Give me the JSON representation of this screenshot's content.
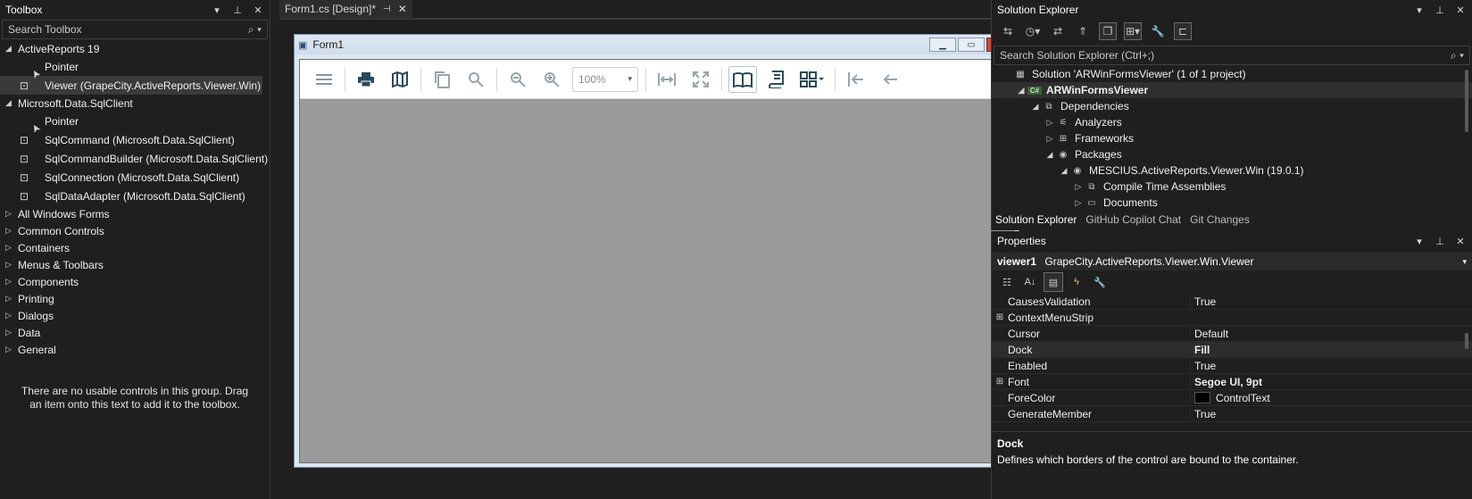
{
  "toolbox": {
    "title": "Toolbox",
    "search_placeholder": "Search Toolbox",
    "groups": [
      {
        "label": "ActiveReports 19",
        "expanded": true,
        "items": [
          "Pointer",
          "Viewer (GrapeCity.ActiveReports.Viewer.Win)"
        ]
      },
      {
        "label": "Microsoft.Data.SqlClient",
        "expanded": true,
        "items": [
          "Pointer",
          "SqlCommand (Microsoft.Data.SqlClient)",
          "SqlCommandBuilder (Microsoft.Data.SqlClient)",
          "SqlConnection (Microsoft.Data.SqlClient)",
          "SqlDataAdapter (Microsoft.Data.SqlClient)"
        ]
      },
      {
        "label": "All Windows Forms"
      },
      {
        "label": "Common Controls"
      },
      {
        "label": "Containers"
      },
      {
        "label": "Menus & Toolbars"
      },
      {
        "label": "Components"
      },
      {
        "label": "Printing"
      },
      {
        "label": "Dialogs"
      },
      {
        "label": "Data"
      },
      {
        "label": "General"
      }
    ],
    "empty_message": "There are no usable controls in this group. Drag an item onto this text to add it to the toolbox."
  },
  "document": {
    "tab_label": "Form1.cs [Design]*",
    "form_title": "Form1",
    "zoom": "100%"
  },
  "solution_explorer": {
    "title": "Solution Explorer",
    "search_placeholder": "Search Solution Explorer (Ctrl+;)",
    "tree": [
      {
        "label": "Solution 'ARWinFormsViewer' (1 of 1 project)",
        "level": 0,
        "tri": ""
      },
      {
        "label": "ARWinFormsViewer",
        "level": 1,
        "tri": "◢"
      },
      {
        "label": "Dependencies",
        "level": 2,
        "tri": "◢"
      },
      {
        "label": "Analyzers",
        "level": 3,
        "tri": "▷"
      },
      {
        "label": "Frameworks",
        "level": 3,
        "tri": "▷"
      },
      {
        "label": "Packages",
        "level": 3,
        "tri": "◢"
      },
      {
        "label": "MESCIUS.ActiveReports.Viewer.Win (19.0.1)",
        "level": 4,
        "tri": "◢"
      },
      {
        "label": "Compile Time Assemblies",
        "level": 5,
        "tri": "▷"
      },
      {
        "label": "Documents",
        "level": 5,
        "tri": "▷"
      }
    ],
    "tabs": [
      "Solution Explorer",
      "GitHub Copilot Chat",
      "Git Changes"
    ]
  },
  "properties": {
    "title": "Properties",
    "object_name": "viewer1",
    "object_type": "GrapeCity.ActiveReports.Viewer.Win.Viewer",
    "rows": [
      {
        "name": "CausesValidation",
        "value": "True",
        "expandable": false,
        "bold": false
      },
      {
        "name": "ContextMenuStrip",
        "value": "",
        "expandable": true,
        "bold": false
      },
      {
        "name": "Cursor",
        "value": "Default",
        "expandable": false,
        "bold": false
      },
      {
        "name": "Dock",
        "value": "Fill",
        "expandable": false,
        "bold": true
      },
      {
        "name": "Enabled",
        "value": "True",
        "expandable": false,
        "bold": false
      },
      {
        "name": "Font",
        "value": "Segoe UI, 9pt",
        "expandable": true,
        "bold": true
      },
      {
        "name": "ForeColor",
        "value": "ControlText",
        "expandable": false,
        "bold": false,
        "swatch": true
      },
      {
        "name": "GenerateMember",
        "value": "True",
        "expandable": false,
        "bold": false
      }
    ],
    "desc_title": "Dock",
    "desc_text": "Defines which borders of the control are bound to the container."
  }
}
